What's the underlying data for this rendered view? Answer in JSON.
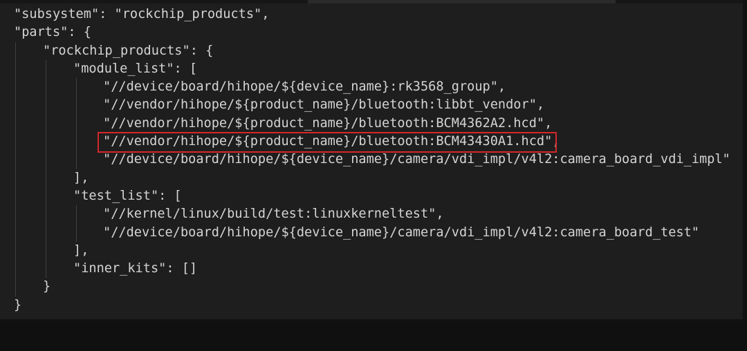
{
  "editor": {
    "highlight_color": "#d4282b",
    "lines": [
      {
        "indent": 0,
        "text": "\"subsystem\": \"rockchip_products\","
      },
      {
        "indent": 0,
        "text": "\"parts\": {"
      },
      {
        "indent": 1,
        "text": "\"rockchip_products\": {"
      },
      {
        "indent": 2,
        "text": "\"module_list\": ["
      },
      {
        "indent": 3,
        "text": "\"//device/board/hihope/${device_name}:rk3568_group\","
      },
      {
        "indent": 3,
        "text": "\"//vendor/hihope/${product_name}/bluetooth:libbt_vendor\","
      },
      {
        "indent": 3,
        "text": "\"//vendor/hihope/${product_name}/bluetooth:BCM4362A2.hcd\","
      },
      {
        "indent": 3,
        "text": "\"//vendor/hihope/${product_name}/bluetooth:BCM43430A1.hcd\",",
        "highlighted": true
      },
      {
        "indent": 3,
        "text": "\"//device/board/hihope/${device_name}/camera/vdi_impl/v4l2:camera_board_vdi_impl\""
      },
      {
        "indent": 2,
        "text": "],"
      },
      {
        "indent": 2,
        "text": "\"test_list\": ["
      },
      {
        "indent": 3,
        "text": "\"//kernel/linux/build/test:linuxkerneltest\","
      },
      {
        "indent": 3,
        "text": "\"//device/board/hihope/${device_name}/camera/vdi_impl/v4l2:camera_board_test\""
      },
      {
        "indent": 2,
        "text": "],"
      },
      {
        "indent": 2,
        "text": "\"inner_kits\": []"
      },
      {
        "indent": 1,
        "text": "}"
      },
      {
        "indent": 0,
        "text": "}"
      }
    ]
  }
}
